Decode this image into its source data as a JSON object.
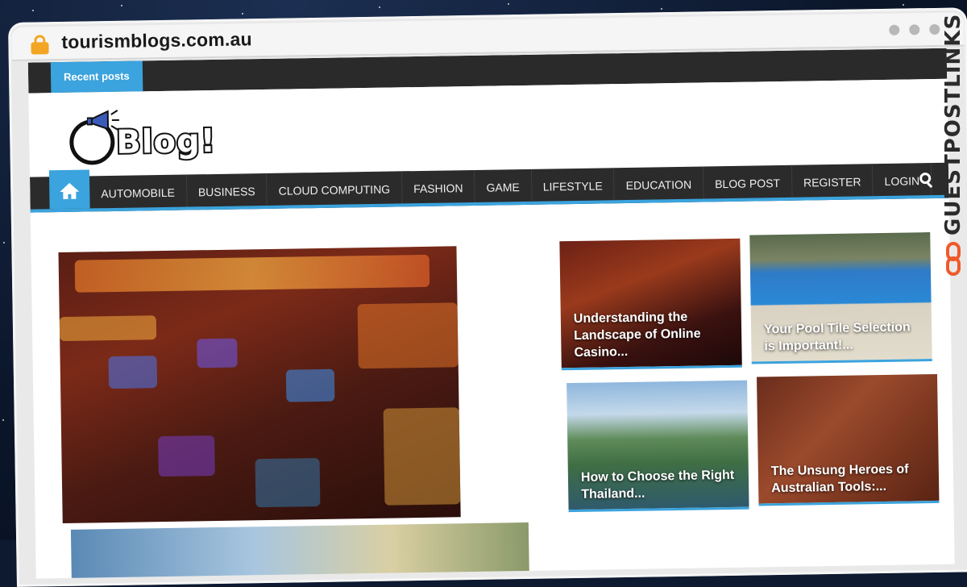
{
  "browser": {
    "url": "tourismblogs.com.au"
  },
  "site": {
    "topbar_label": "Recent posts",
    "logo_text": "Blog!",
    "nav": [
      "AUTOMOBILE",
      "BUSINESS",
      "CLOUD COMPUTING",
      "FASHION",
      "GAME",
      "LIFESTYLE",
      "EDUCATION",
      "BLOG POST",
      "REGISTER",
      "LOGIN"
    ],
    "cards": [
      "Understanding the Landscape of Online Casino...",
      "Your Pool Tile Selection is Important!...",
      "How to Choose the Right Thailand...",
      "The Unsung Heroes of Australian Tools:..."
    ]
  },
  "watermark": "GUESTPOSTLINKS",
  "colors": {
    "accent": "#3ba3dd",
    "nav_bg": "#2b2b2b",
    "lock": "#f3a623",
    "brand": "#ef5a2a"
  },
  "icons": [
    "lock-icon",
    "home-icon",
    "search-icon",
    "megaphone-icon",
    "link-icon"
  ]
}
